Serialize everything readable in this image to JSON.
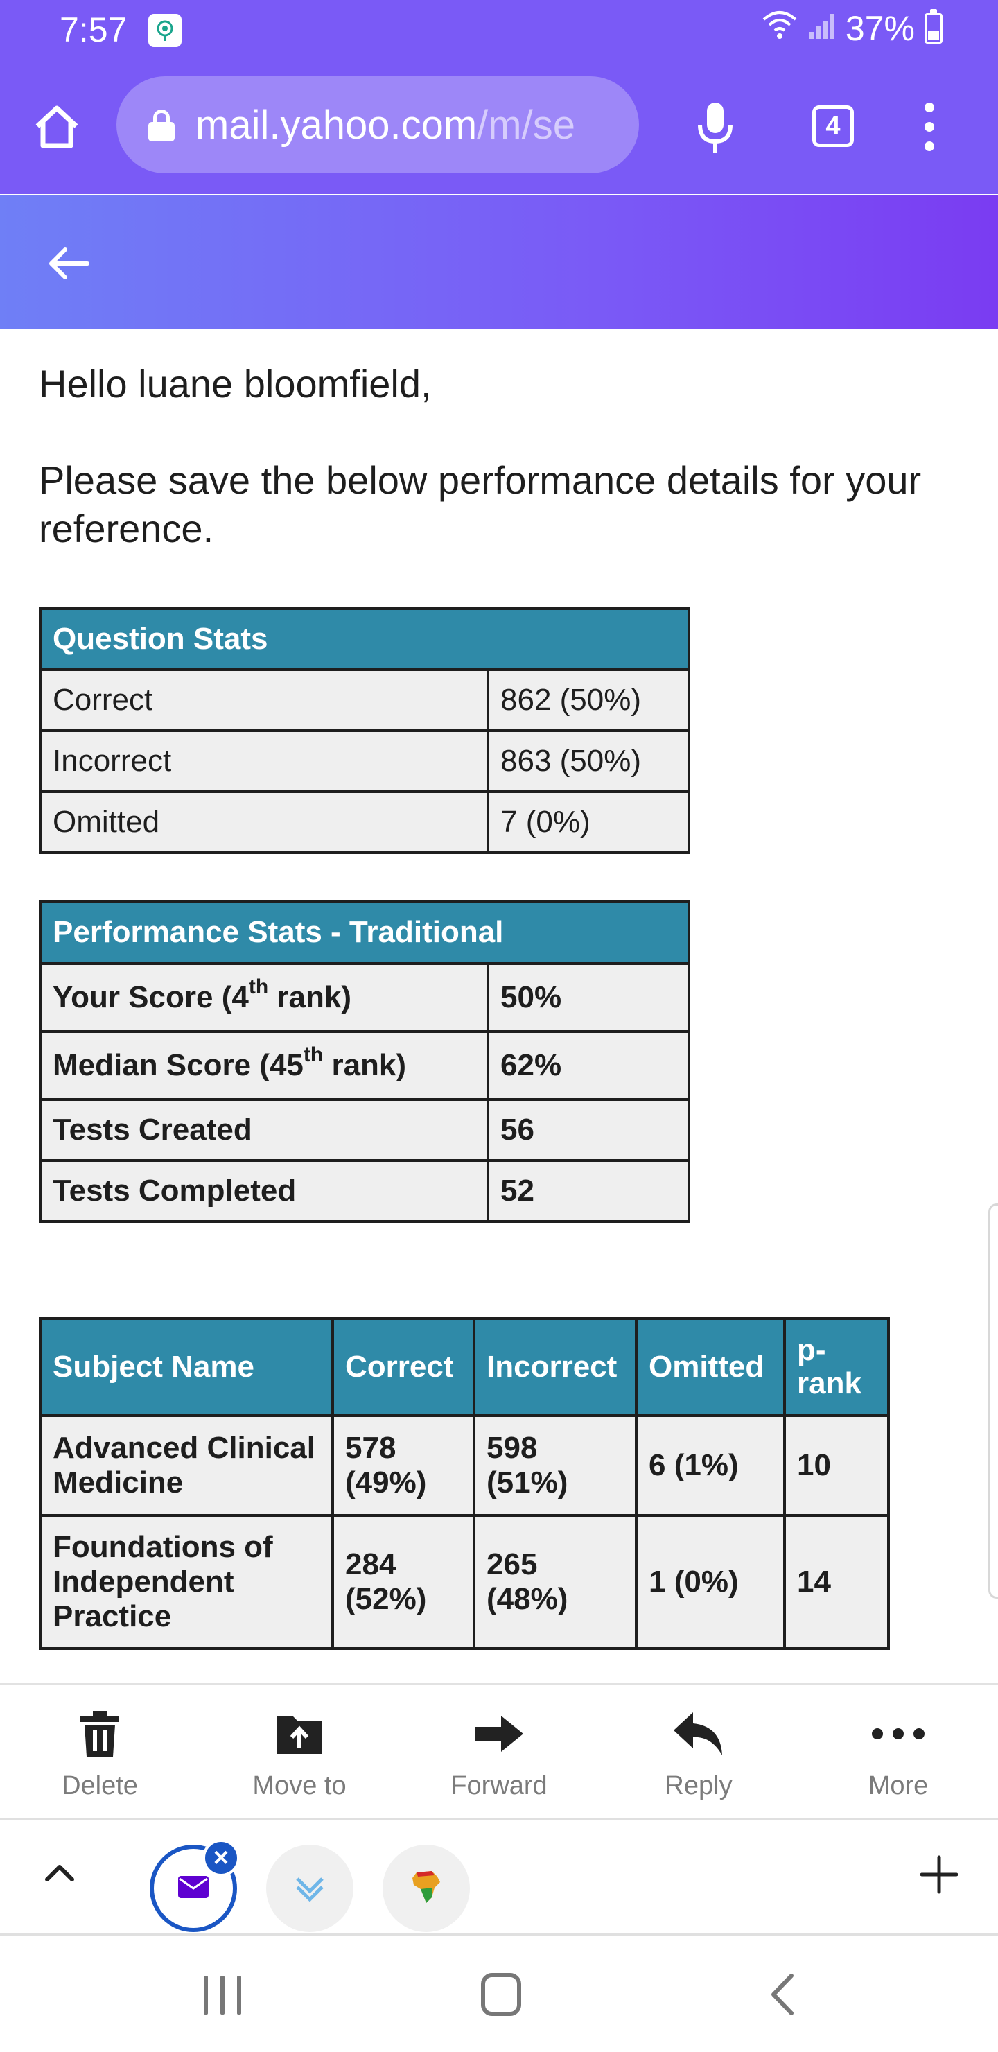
{
  "status_bar": {
    "time": "7:57",
    "battery": "37%"
  },
  "browser": {
    "url_host": "mail.yahoo.com",
    "url_path": "/m/se",
    "tab_count": "4"
  },
  "email": {
    "greeting": "Hello luane bloomfield,",
    "intro": "Please save the below performance details for your reference."
  },
  "question_stats": {
    "title": "Question Stats",
    "rows": [
      {
        "label": "Correct",
        "value": "862 (50%)"
      },
      {
        "label": "Incorrect",
        "value": "863 (50%)"
      },
      {
        "label": "Omitted",
        "value": "7 (0%)"
      }
    ]
  },
  "performance_stats": {
    "title": "Performance Stats - Traditional",
    "your_score_label": "Your Score (4",
    "your_score_sup": "th",
    "your_score_suffix": " rank)",
    "your_score_value": "50%",
    "median_label": "Median Score (45",
    "median_sup": "th",
    "median_suffix": " rank)",
    "median_value": "62%",
    "tests_created_label": "Tests Created",
    "tests_created_value": "56",
    "tests_completed_label": "Tests Completed",
    "tests_completed_value": "52"
  },
  "subject_table": {
    "headers": [
      "Subject Name",
      "Correct",
      "Incorrect",
      "Omitted",
      "p-rank"
    ],
    "rows": [
      {
        "subject": "Advanced Clinical Medicine",
        "correct": "578 (49%)",
        "incorrect": "598 (51%)",
        "omitted": "6 (1%)",
        "prank": "10"
      },
      {
        "subject": "Foundations of Independent Practice",
        "correct": "284 (52%)",
        "incorrect": "265 (48%)",
        "omitted": "1 (0%)",
        "prank": "14"
      }
    ]
  },
  "actions": {
    "delete": "Delete",
    "move_to": "Move to",
    "forward": "Forward",
    "reply": "Reply",
    "more": "More"
  },
  "colors": {
    "chrome_purple": "#7a5af6",
    "table_header_teal": "#2f8aa8",
    "active_tab_blue": "#1a56c4"
  }
}
